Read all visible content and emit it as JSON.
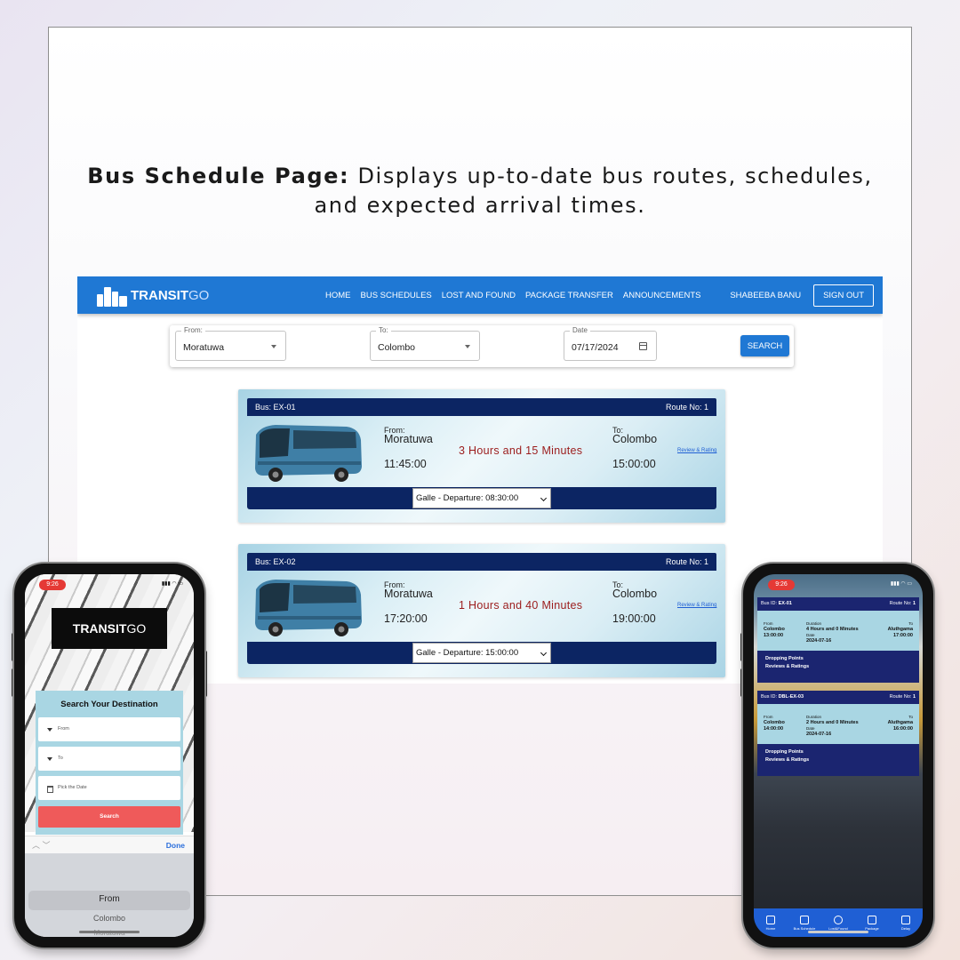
{
  "headline": {
    "bold": "Bus Schedule Page:",
    "text": " Displays up-to-date bus routes, schedules, and expected arrival times."
  },
  "desktop": {
    "brand": {
      "main": "TRANSIT",
      "suffix": "GO"
    },
    "nav": [
      "HOME",
      "BUS SCHEDULES",
      "LOST AND FOUND",
      "PACKAGE TRANSFER",
      "ANNOUNCEMENTS"
    ],
    "user": "SHABEEBA BANU",
    "signout": "SIGN OUT",
    "search": {
      "from_label": "From:",
      "from_value": "Moratuwa",
      "to_label": "To:",
      "to_value": "Colombo",
      "date_label": "Date",
      "date_value": "07/17/2024",
      "button": "SEARCH"
    },
    "cards": [
      {
        "bus": "Bus: EX-01",
        "route": "Route No: 1",
        "from_label": "From:",
        "from": "Moratuwa",
        "to_label": "To:",
        "to": "Colombo",
        "departure": "11:45:00",
        "arrival": "15:00:00",
        "duration": "3 Hours and 15 Minutes",
        "review": "Review & Rating",
        "stop": "Galle - Departure: 08:30:00"
      },
      {
        "bus": "Bus: EX-02",
        "route": "Route No: 1",
        "from_label": "From:",
        "from": "Moratuwa",
        "to_label": "To:",
        "to": "Colombo",
        "departure": "17:20:00",
        "arrival": "19:00:00",
        "duration": "1 Hours and 40 Minutes",
        "review": "Review & Rating",
        "stop": "Galle - Departure: 15:00:00"
      }
    ]
  },
  "mobile_left": {
    "time": "9:26",
    "brand": {
      "main": "TRANSIT",
      "suffix": "GO"
    },
    "panel_title": "Search Your Destination",
    "from_placeholder": "From",
    "to_placeholder": "To",
    "date_placeholder": "Pick the Date",
    "search_button": "Search",
    "done": "Done",
    "picker": [
      "From",
      "Colombo",
      "Moratuwa"
    ]
  },
  "mobile_right": {
    "time": "9:26",
    "cards": [
      {
        "bus_label": "Bus ID:",
        "bus": "EX-01",
        "route_label": "Route No:",
        "route": "1",
        "from_label": "From",
        "from": "Colombo",
        "dep": "13:00:00",
        "duration_label": "Duration",
        "duration": "4 Hours and 0 Minutes",
        "date_label": "Date",
        "date": "2024-07-16",
        "to_label": "To",
        "to": "Aluthgama",
        "arr": "17:00:00",
        "dropping": "Dropping Points",
        "reviews": "Reviews & Ratings"
      },
      {
        "bus_label": "Bus ID:",
        "bus": "DBL-EX-03",
        "route_label": "Route No:",
        "route": "1",
        "from_label": "From",
        "from": "Colombo",
        "dep": "14:00:00",
        "duration_label": "Duration",
        "duration": "2 Hours and 0 Minutes",
        "date_label": "Date",
        "date": "2024-07-16",
        "to_label": "To",
        "to": "Aluthgama",
        "arr": "16:00:00",
        "dropping": "Dropping Points",
        "reviews": "Reviews & Ratings"
      }
    ],
    "tabs": [
      "Home",
      "Bus Schedule",
      "Lost&Found",
      "Package",
      "Delay"
    ]
  },
  "colors": {
    "nav_blue": "#1f78d4",
    "card_navy": "#0c2563",
    "duration_red": "#9b1c1c",
    "mobile_search": "#ef5a5a"
  }
}
